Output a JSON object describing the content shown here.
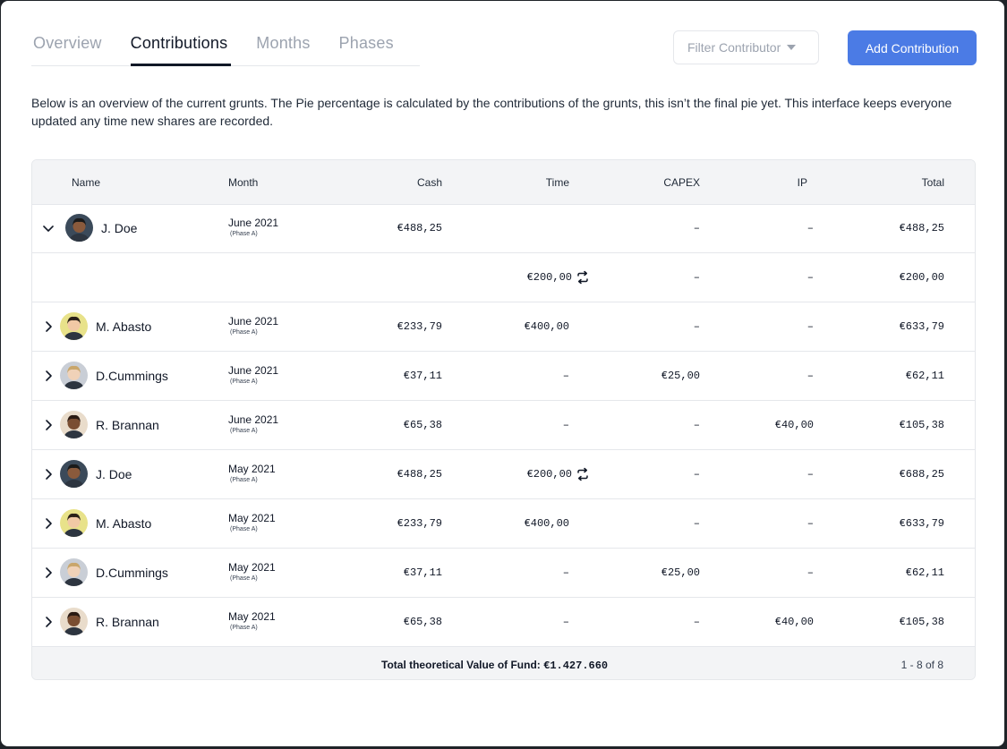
{
  "tabs": [
    "Overview",
    "Contributions",
    "Months",
    "Phases"
  ],
  "filter": {
    "placeholder": "Filter Contributor"
  },
  "add_button": "Add Contribution",
  "description": "Below is an overview of the current grunts. The Pie percentage is calculated by the contributions of the grunts, this isn’t the final pie yet. This interface keeps everyone updated any time new shares are recorded.",
  "columns": [
    "Name",
    "Month",
    "Cash",
    "Time",
    "CAPEX",
    "IP",
    "Total"
  ],
  "rows": [
    {
      "name": "J. Doe",
      "month": "June 2021",
      "phase": "(Phase A)",
      "cash": "€488,25",
      "time": "",
      "capex": "–",
      "ip": "–",
      "total": "€488,25",
      "expanded": true,
      "avatar": "dark-hair-man"
    },
    {
      "sub": true,
      "cash": "",
      "time": "€200,00",
      "capex": "–",
      "ip": "–",
      "total": "€200,00",
      "recurring": true
    },
    {
      "name": "M. Abasto",
      "month": "June 2021",
      "phase": "(Phase A)",
      "cash": "€233,79",
      "time": "€400,00",
      "capex": "–",
      "ip": "–",
      "total": "€633,79",
      "avatar": "woman-yellow"
    },
    {
      "name": "D.Cummings",
      "month": "June 2021",
      "phase": "(Phase A)",
      "cash": "€37,11",
      "time": "–",
      "capex": "€25,00",
      "ip": "–",
      "total": "€62,11",
      "avatar": "blonde-woman"
    },
    {
      "name": "R. Brannan",
      "month": "June 2021",
      "phase": "(Phase A)",
      "cash": "€65,38",
      "time": "–",
      "capex": "–",
      "ip": "€40,00",
      "total": "€105,38",
      "avatar": "man-beige"
    },
    {
      "name": "J. Doe",
      "month": "May 2021",
      "phase": "(Phase A)",
      "cash": "€488,25",
      "time": "€200,00",
      "capex": "–",
      "ip": "–",
      "total": "€688,25",
      "recurring": true,
      "avatar": "dark-hair-man"
    },
    {
      "name": "M. Abasto",
      "month": "May 2021",
      "phase": "(Phase A)",
      "cash": "€233,79",
      "time": "€400,00",
      "capex": "–",
      "ip": "–",
      "total": "€633,79",
      "avatar": "woman-yellow"
    },
    {
      "name": "D.Cummings",
      "month": "May 2021",
      "phase": "(Phase A)",
      "cash": "€37,11",
      "time": "–",
      "capex": "€25,00",
      "ip": "–",
      "total": "€62,11",
      "avatar": "blonde-woman"
    },
    {
      "name": "R. Brannan",
      "month": "May 2021",
      "phase": "(Phase A)",
      "cash": "€65,38",
      "time": "–",
      "capex": "–",
      "ip": "€40,00",
      "total": "€105,38",
      "avatar": "man-beige"
    }
  ],
  "footer": {
    "label": "Total theoretical Value of Fund: ",
    "value": "€1.427.660",
    "pagination": "1 - 8 of 8"
  },
  "colors": {
    "accent": "#4b7be5",
    "header_bg": "#f3f4f6",
    "border": "#e5e7eb"
  }
}
